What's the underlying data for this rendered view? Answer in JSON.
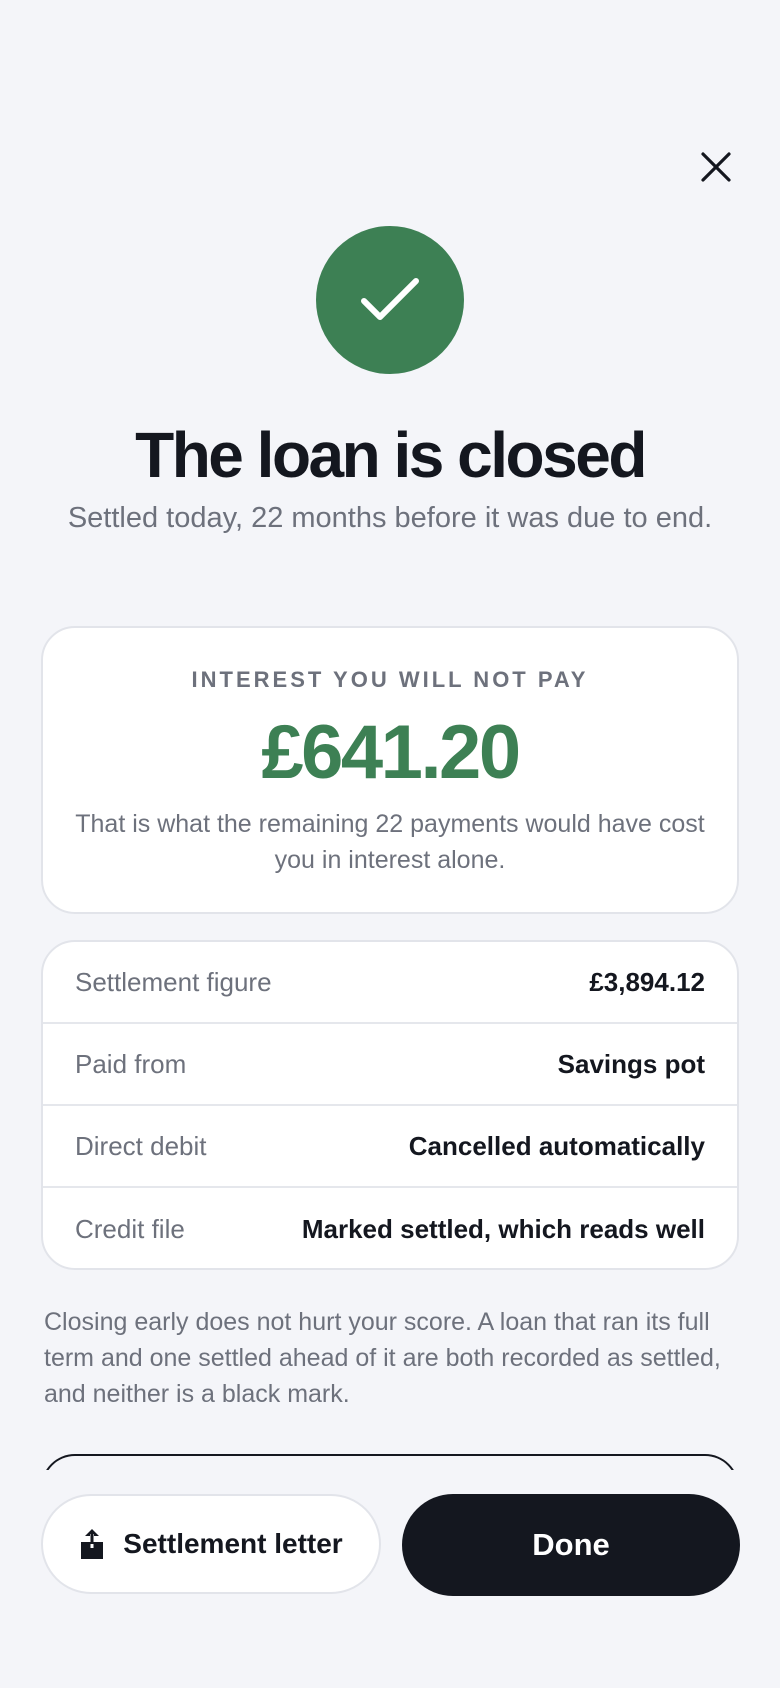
{
  "header": {
    "close_icon": "close-icon"
  },
  "status": {
    "icon": "check-icon",
    "color": "#3d8054",
    "title": "The loan is closed",
    "subtitle": "Settled today, 22 months before it was due to end."
  },
  "savings": {
    "label": "INTEREST YOU WILL NOT PAY",
    "amount": "£641.20",
    "note": "That is what the remaining 22 payments would have cost you in interest alone."
  },
  "details": [
    {
      "label": "Settlement figure",
      "value": "£3,894.12"
    },
    {
      "label": "Paid from",
      "value": "Savings pot"
    },
    {
      "label": "Direct debit",
      "value": "Cancelled automatically"
    },
    {
      "label": "Credit file",
      "value": "Marked settled, which reads well"
    }
  ],
  "footnote": "Closing early does not hurt your score. A loan that ran its full term and one settled ahead of it are both recorded as settled, and neither is a black mark.",
  "actions": {
    "letter_label": "Settlement letter",
    "letter_icon": "share-icon",
    "done_label": "Done"
  },
  "colors": {
    "background": "#f4f5f9",
    "accent": "#3d8054",
    "primary_button": "#14171f",
    "muted_text": "#6d717c"
  }
}
